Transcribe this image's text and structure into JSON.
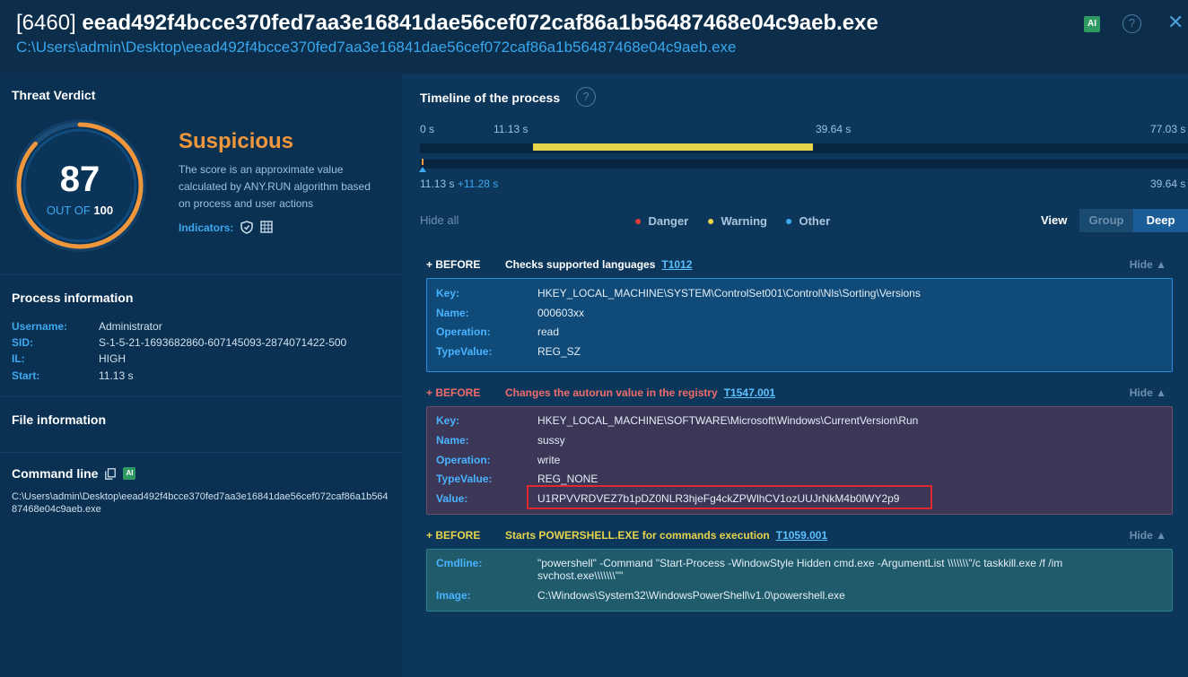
{
  "header": {
    "pid": "[6460]",
    "filename": "eead492f4bcce370fed7aa3e16841dae56cef072caf86a1b56487468e04c9aeb.exe",
    "path": "C:\\Users\\admin\\Desktop\\eead492f4bcce370fed7aa3e16841dae56cef072caf86a1b56487468e04c9aeb.exe",
    "ai_label": "AI",
    "help_label": "?",
    "close_label": "✕"
  },
  "verdict": {
    "section_title": "Threat Verdict",
    "score": "87",
    "out_of_prefix": "OUT OF",
    "out_of_value": "100",
    "score_fraction": 0.87,
    "label": "Suspicious",
    "description": "The score is an approximate value calculated by ANY.RUN algorithm based on process and user actions",
    "indicators_label": "Indicators:",
    "colors": {
      "gauge": "#f0973d",
      "verdict": "#f0973d"
    }
  },
  "process_info": {
    "title": "Process information",
    "rows": [
      {
        "key": "Username:",
        "value": "Administrator"
      },
      {
        "key": "SID:",
        "value": "S-1-5-21-1693682860-607145093-2874071422-500"
      },
      {
        "key": "IL:",
        "value": "HIGH"
      },
      {
        "key": "Start:",
        "value": "11.13 s"
      }
    ]
  },
  "file_info": {
    "title": "File information"
  },
  "command_line": {
    "title": "Command line",
    "ai_label": "AI",
    "text": "C:\\Users\\admin\\Desktop\\eead492f4bcce370fed7aa3e16841dae56cef072caf86a1b56487468e04c9aeb.exe"
  },
  "timeline": {
    "title": "Timeline of the process",
    "help_label": "?",
    "ticks": [
      "0 s",
      "11.13 s",
      "39.64 s",
      "77.03 s"
    ],
    "bar_start_s": 11.13,
    "bar_end_s": 39.64,
    "total_s": 77.03,
    "sub_start": "11.13 s",
    "sub_delta": "+11.28 s",
    "sub_end": "39.64 s"
  },
  "filters": {
    "hide_all": "Hide all",
    "legend": [
      {
        "label": "Danger",
        "color": "#e23b3b"
      },
      {
        "label": "Warning",
        "color": "#e8d44a"
      },
      {
        "label": "Other",
        "color": "#3ea8f0"
      }
    ],
    "view_label": "View",
    "view_options": [
      "Group",
      "Deep"
    ],
    "view_selected": "Deep"
  },
  "events": [
    {
      "before": "+ BEFORE",
      "description": "Checks supported languages",
      "technique": "T1012",
      "hide": "Hide",
      "severity_color": "#ffffff",
      "rows": [
        {
          "key": "Key:",
          "value": "HKEY_LOCAL_MACHINE\\SYSTEM\\ControlSet001\\Control\\Nls\\Sorting\\Versions"
        },
        {
          "key": "Name:",
          "value": "000603xx"
        },
        {
          "key": "Operation:",
          "value": "read"
        },
        {
          "key": "TypeValue:",
          "value": "REG_SZ"
        }
      ]
    },
    {
      "before": "+ BEFORE",
      "description": "Changes the autorun value in the registry",
      "technique": "T1547.001",
      "hide": "Hide",
      "severity_color": "#f06b6b",
      "rows": [
        {
          "key": "Key:",
          "value": "HKEY_LOCAL_MACHINE\\SOFTWARE\\Microsoft\\Windows\\CurrentVersion\\Run"
        },
        {
          "key": "Name:",
          "value": "sussy"
        },
        {
          "key": "Operation:",
          "value": "write"
        },
        {
          "key": "TypeValue:",
          "value": "REG_NONE"
        },
        {
          "key": "Value:",
          "value": "U1RPVVRDVEZ7b1pDZ0NLR3hjeFg4ckZPWlhCV1ozUUJrNkM4b0lWY2p9"
        }
      ]
    },
    {
      "before": "+ BEFORE",
      "description": "Starts POWERSHELL.EXE for commands execution",
      "technique": "T1059.001",
      "hide": "Hide",
      "severity_color": "#e8d44a",
      "rows": [
        {
          "key": "Cmdline:",
          "value": "\"powershell\" -Command \"Start-Process -WindowStyle Hidden cmd.exe -ArgumentList \\\\\\\\\\\\\\\"/c taskkill.exe /f /im",
          "value2": "svchost.exe\\\\\\\\\\\\\\\"\""
        },
        {
          "key": "Image:",
          "value": "C:\\Windows\\System32\\WindowsPowerShell\\v1.0\\powershell.exe"
        }
      ]
    }
  ]
}
